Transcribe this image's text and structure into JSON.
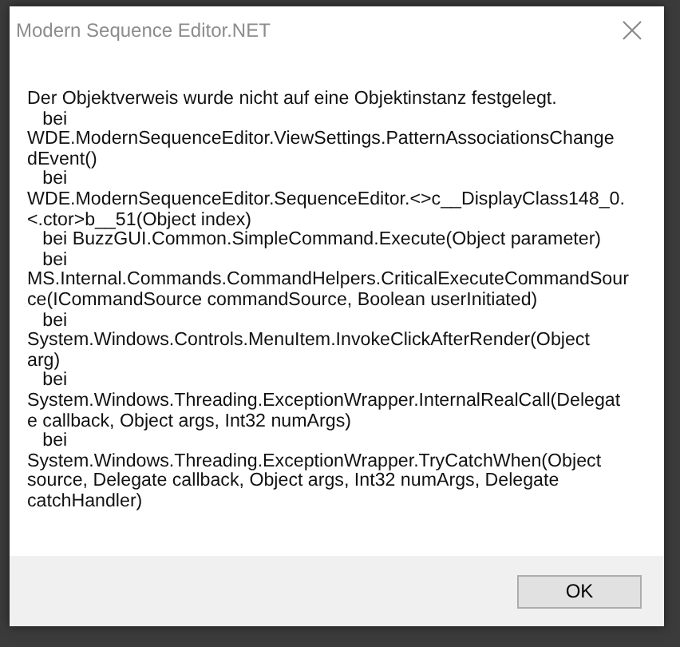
{
  "window": {
    "title": "Modern Sequence Editor.NET"
  },
  "message": "Der Objektverweis wurde nicht auf eine Objektinstanz festgelegt.\n   bei\nWDE.ModernSequenceEditor.ViewSettings.PatternAssociationsChange\ndEvent()\n   bei\nWDE.ModernSequenceEditor.SequenceEditor.<>c__DisplayClass148_0.\n<.ctor>b__51(Object index)\n   bei BuzzGUI.Common.SimpleCommand.Execute(Object parameter)\n   bei\nMS.Internal.Commands.CommandHelpers.CriticalExecuteCommandSour\nce(ICommandSource commandSource, Boolean userInitiated)\n   bei\nSystem.Windows.Controls.MenuItem.InvokeClickAfterRender(Object\narg)\n   bei\nSystem.Windows.Threading.ExceptionWrapper.InternalRealCall(Delegat\ne callback, Object args, Int32 numArgs)\n   bei\nSystem.Windows.Threading.ExceptionWrapper.TryCatchWhen(Object\nsource, Delegate callback, Object args, Int32 numArgs, Delegate\ncatchHandler)",
  "buttons": [
    "OK"
  ]
}
